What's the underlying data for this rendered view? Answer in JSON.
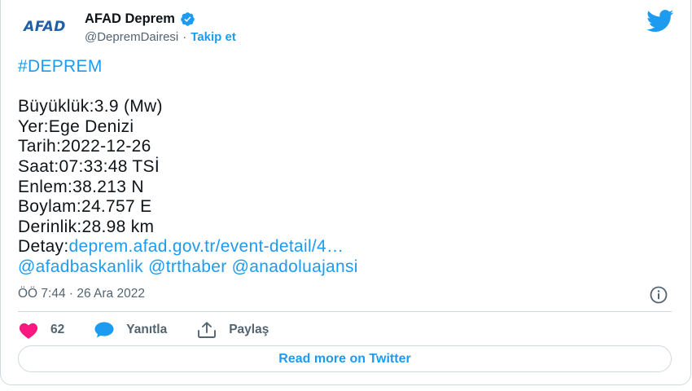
{
  "colors": {
    "accent": "#1d9bf0",
    "text": "#0f1419",
    "muted": "#536471",
    "heart": "#f91880",
    "afad_logo": "#1f5fa8"
  },
  "author": {
    "logo_text": "AFAD",
    "name": "AFAD Deprem",
    "handle": "@DepremDairesi",
    "separator": "·",
    "follow_label": "Takip et"
  },
  "tweet": {
    "hashtag": "#DEPREM",
    "lines": {
      "magnitude": "Büyüklük:3.9 (Mw)",
      "location": "Yer:Ege Denizi",
      "date": "Tarih:2022-12-26",
      "time": "Saat:07:33:48 TSİ",
      "latitude": "Enlem:38.213 N",
      "longitude": "Boylam:24.757 E",
      "depth": "Derinlik:28.98 km"
    },
    "detail_prefix": "Detay:",
    "detail_link": "deprem.afad.gov.tr/event-detail/4…",
    "mentions": [
      "@afadbaskanlik",
      "@trthaber",
      "@anadoluajansi"
    ]
  },
  "meta": {
    "timestamp": "ÖÖ 7:44 · 26 Ara 2022"
  },
  "actions": {
    "like_count": "62",
    "reply_label": "Yanıtla",
    "share_label": "Paylaş"
  },
  "footer": {
    "read_more_label": "Read more on Twitter"
  },
  "icons": {
    "verified": "verified-badge-icon",
    "twitter": "twitter-bird-icon",
    "info": "info-icon",
    "like": "heart-icon",
    "reply": "speech-bubble-icon",
    "share": "share-upload-icon"
  }
}
